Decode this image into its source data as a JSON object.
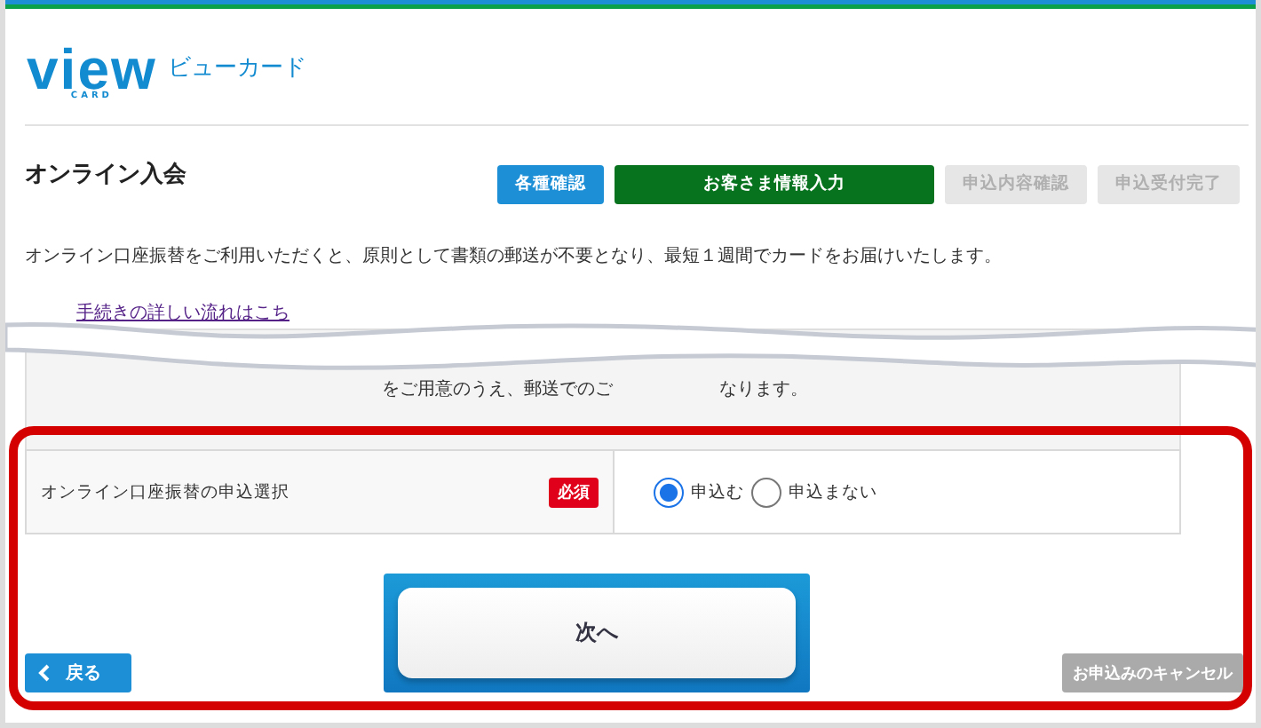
{
  "logo": {
    "wordmark": "view",
    "sub": "CARD",
    "katakana": "ビューカード"
  },
  "page_title": "オンライン入会",
  "steps": [
    {
      "label": "各種確認",
      "kind": "done"
    },
    {
      "label": "お客さま情報入力",
      "kind": "current"
    },
    {
      "label": "申込内容確認",
      "kind": "todo"
    },
    {
      "label": "申込受付完了",
      "kind": "todo"
    }
  ],
  "intro": "オンライン口座振替をご利用いただくと、原則として書類の郵送が不要となり、最短１週間でカードをお届けいたします。",
  "flow_link": "手続きの詳しい流れはこち",
  "notice_fragment": "をご用意のうえ、郵送でのご",
  "notice_end": "なります。",
  "field": {
    "label": "オンライン口座振替の申込選択",
    "required": "必須",
    "options": [
      {
        "label": "申込む",
        "selected": true
      },
      {
        "label": "申込まない",
        "selected": false
      }
    ]
  },
  "next_button": "次へ",
  "back_button": "戻る",
  "cancel_button": "お申込みのキャンセル"
}
